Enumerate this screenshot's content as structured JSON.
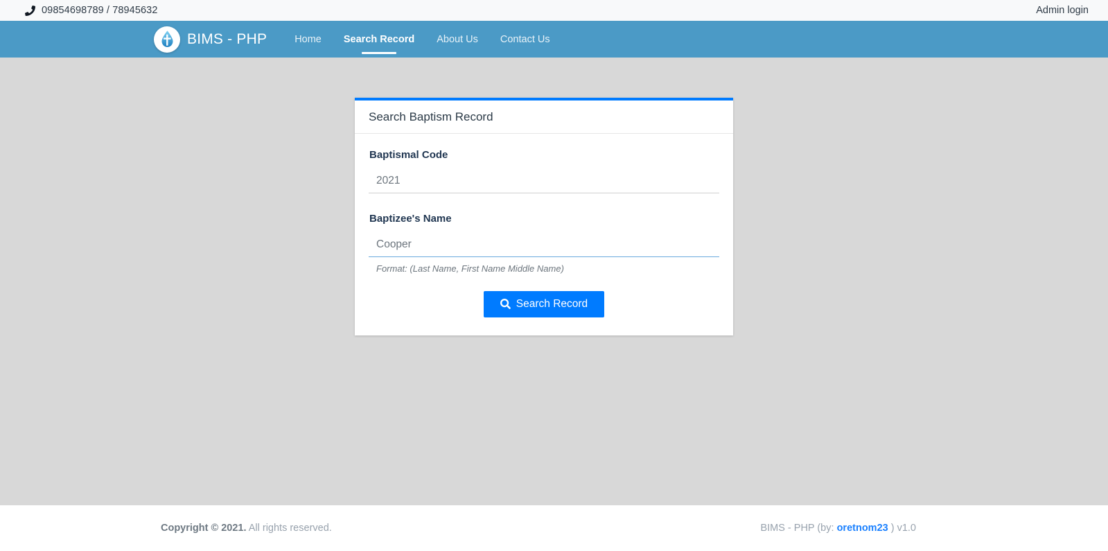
{
  "topbar": {
    "phone_icon": "phone-icon",
    "phone": "09854698789 / 78945632",
    "admin_login": "Admin login"
  },
  "navbar": {
    "logo_icon": "baptism-droplet-cross-icon",
    "brand": "BIMS - PHP",
    "links": [
      {
        "label": "Home",
        "active": false
      },
      {
        "label": "Search Record",
        "active": true
      },
      {
        "label": "About Us",
        "active": false
      },
      {
        "label": "Contact Us",
        "active": false
      }
    ],
    "background_color": "#4b9ac6"
  },
  "card": {
    "accent_color": "#007bff",
    "title": "Search Baptism Record",
    "fields": [
      {
        "label": "Baptismal Code",
        "value": "2021",
        "placeholder": "2021",
        "focused": false
      },
      {
        "label": "Baptizee's Name",
        "value": "Cooper",
        "placeholder": "Cooper",
        "focused": true,
        "hint": "Format: (Last Name, First Name Middle Name)"
      }
    ],
    "submit": {
      "icon": "search-icon",
      "label": "Search Record"
    }
  },
  "footer": {
    "copyright_bold": "Copyright © 2021.",
    "copyright_rest": " All rights reserved.",
    "credit_prefix": "BIMS - PHP (by: ",
    "credit_link": "oretnom23",
    "credit_suffix": " ) v1.0"
  }
}
